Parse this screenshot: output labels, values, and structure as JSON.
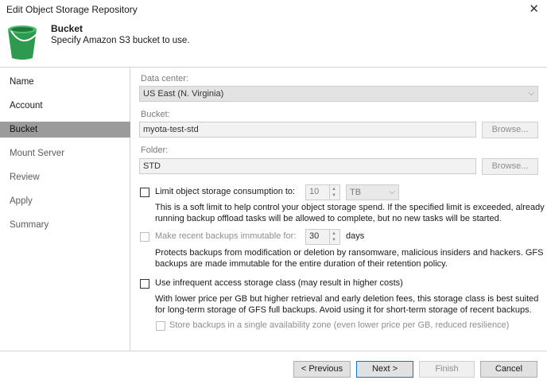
{
  "window": {
    "title": "Edit Object Storage Repository",
    "close_glyph": "✕"
  },
  "header": {
    "title": "Bucket",
    "subtitle": "Specify Amazon S3 bucket to use.",
    "logo_icon": "bucket-icon"
  },
  "sidebar": {
    "items": [
      {
        "label": "Name",
        "state": "normal"
      },
      {
        "label": "Account",
        "state": "normal"
      },
      {
        "label": "Bucket",
        "state": "active"
      },
      {
        "label": "Mount Server",
        "state": "disabled"
      },
      {
        "label": "Review",
        "state": "disabled"
      },
      {
        "label": "Apply",
        "state": "disabled"
      },
      {
        "label": "Summary",
        "state": "disabled"
      }
    ]
  },
  "form": {
    "data_center": {
      "label": "Data center:",
      "value": "US East (N. Virginia)"
    },
    "bucket": {
      "label": "Bucket:",
      "value": "myota-test-std",
      "browse_label": "Browse..."
    },
    "folder": {
      "label": "Folder:",
      "value": "STD",
      "browse_label": "Browse..."
    },
    "limit": {
      "label": "Limit object storage consumption to:",
      "checked": false,
      "value": "10",
      "unit": "TB",
      "description": "This is a soft limit to help control your object storage spend. If the specified limit is exceeded, already running backup offload tasks will be allowed to complete, but no new tasks will be started."
    },
    "immutable": {
      "label": "Make recent backups immutable for:",
      "checked": false,
      "value": "30",
      "unit": "days",
      "description": "Protects backups from modification or deletion by ransomware, malicious insiders and hackers. GFS backups are made immutable for the entire duration of their retention policy."
    },
    "infrequent": {
      "label": "Use infrequent access storage class (may result in higher costs)",
      "checked": false,
      "description": "With lower price per GB but higher retrieval and early deletion fees, this storage class is best suited for long-term storage of GFS full backups. Avoid using it for short-term storage of recent backups."
    },
    "single_zone": {
      "label": "Store backups in a single availability zone (even lower price per GB, reduced resilience)",
      "checked": false
    }
  },
  "footer": {
    "previous": "< Previous",
    "next": "Next >",
    "finish": "Finish",
    "cancel": "Cancel"
  },
  "colors": {
    "active_nav": "#9b9b9b",
    "logo_green": "#2e9a4f",
    "focus_border": "#0078d7"
  }
}
